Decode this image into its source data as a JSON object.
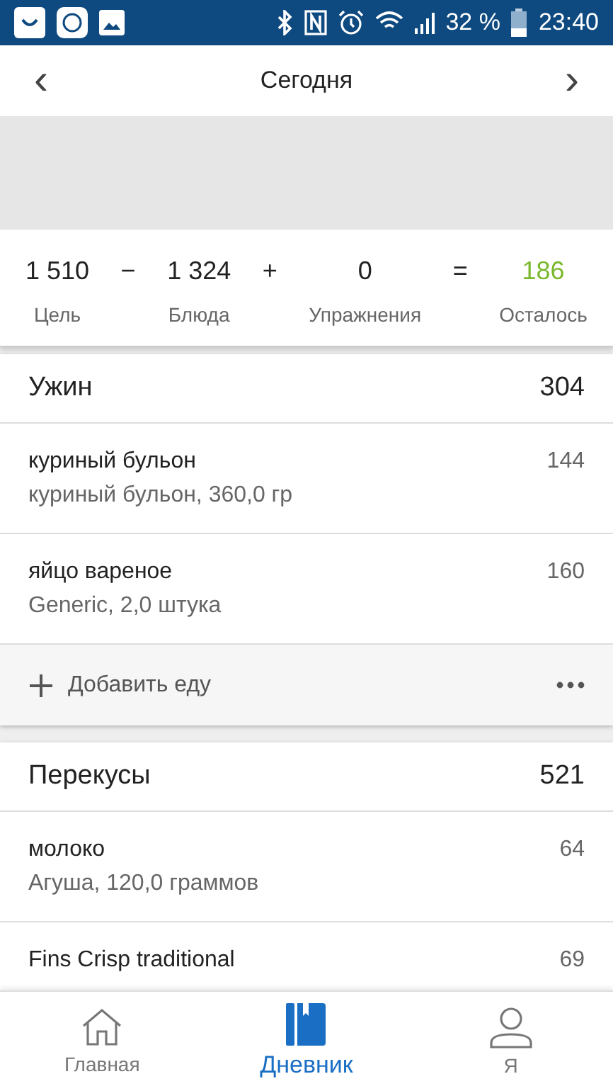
{
  "status_bar": {
    "battery": "32 %",
    "time": "23:40"
  },
  "header": {
    "prev": "‹",
    "title": "Сегодня",
    "next": "›"
  },
  "summary": [
    {
      "kind": "term",
      "value": "1 510",
      "label": "Цель",
      "highlight": false
    },
    {
      "kind": "operator",
      "value": "−"
    },
    {
      "kind": "term",
      "value": "1 324",
      "label": "Блюда",
      "highlight": false
    },
    {
      "kind": "operator",
      "value": "+"
    },
    {
      "kind": "term",
      "value": "0",
      "label": "Упражнения",
      "highlight": false
    },
    {
      "kind": "operator",
      "value": "="
    },
    {
      "kind": "term",
      "value": "186",
      "label": "Осталось",
      "highlight": true
    }
  ],
  "meals": [
    {
      "name": "Ужин",
      "calories": "304",
      "entries": [
        {
          "name": "куриный бульон",
          "detail": "куриный бульон, 360,0 гр",
          "calories": "144"
        },
        {
          "name": "яйцо вареное",
          "detail": "Generic, 2,0 штука",
          "calories": "160"
        }
      ],
      "add_label": "Добавить еду"
    },
    {
      "name": "Перекусы",
      "calories": "521",
      "entries": [
        {
          "name": "молоко",
          "detail": "Агуша, 120,0 граммов",
          "calories": "64"
        },
        {
          "name": "Fins Crisp traditional",
          "calories": "69"
        }
      ]
    }
  ],
  "nav": [
    {
      "kind": "home",
      "label": "Главная",
      "selected": false
    },
    {
      "kind": "diary",
      "label": "Дневник",
      "selected": true
    },
    {
      "kind": "me",
      "label": "Я",
      "selected": false
    }
  ]
}
